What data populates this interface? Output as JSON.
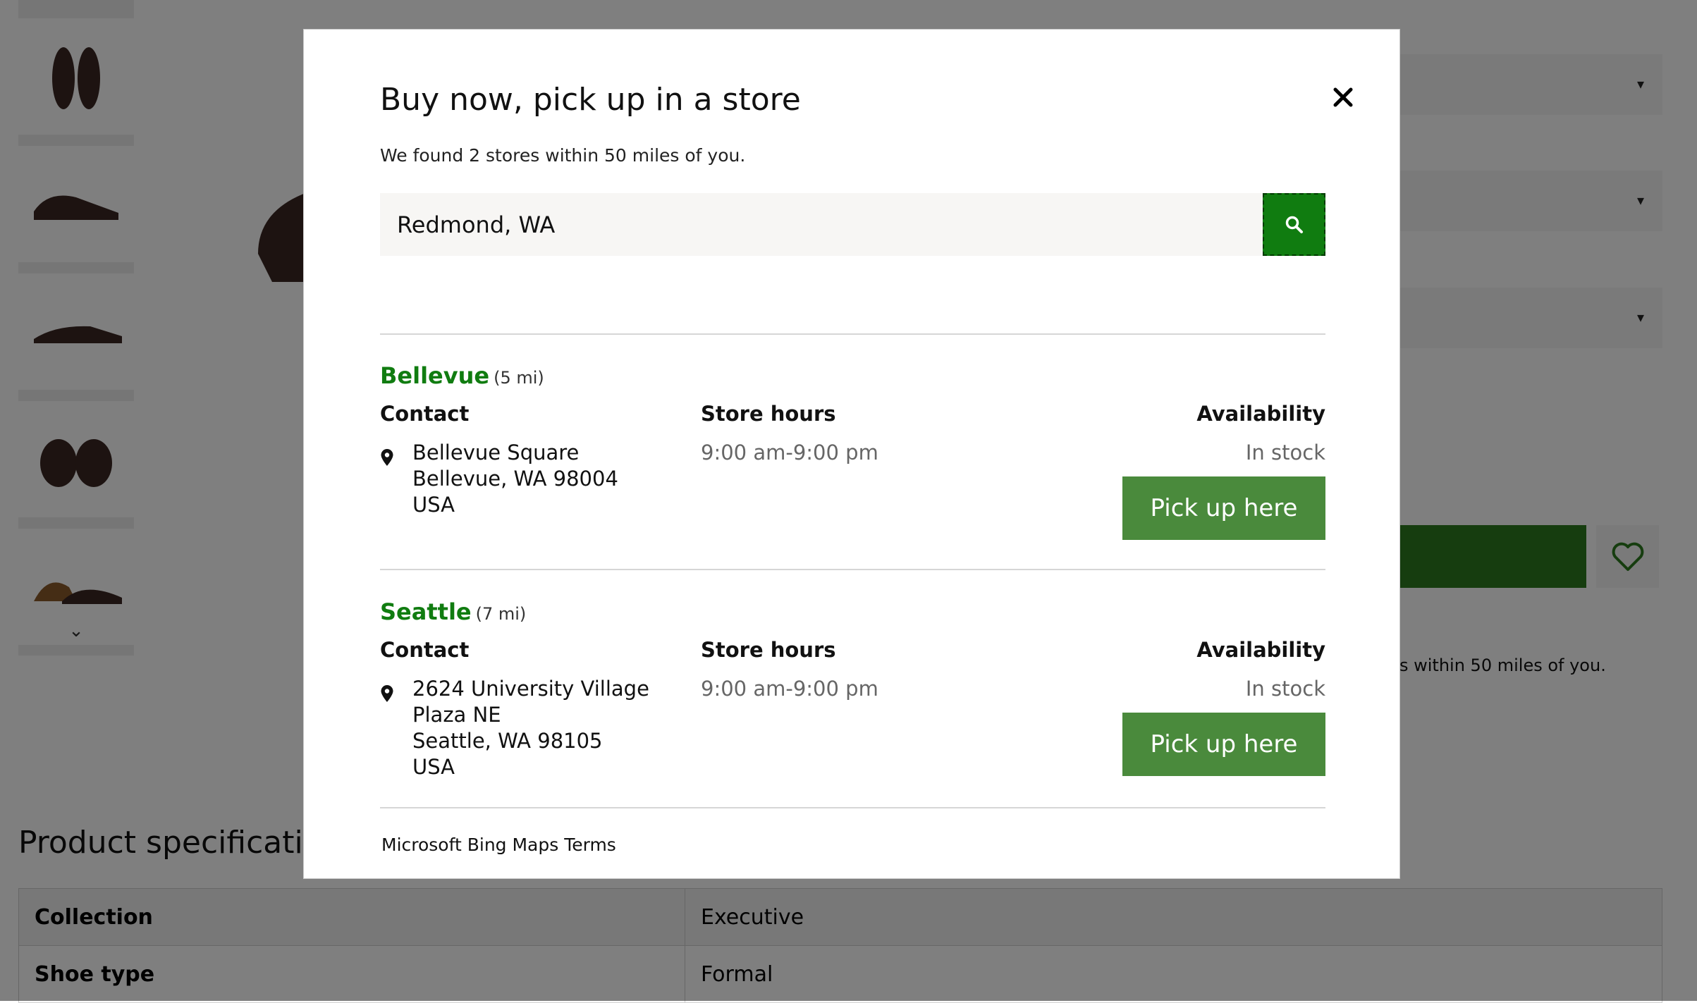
{
  "background": {
    "found_text": "s within 50 miles of you.",
    "spec_title": "Product specifications",
    "specs": [
      {
        "key": "Collection",
        "value": "Executive"
      },
      {
        "key": "Shoe type",
        "value": "Formal"
      }
    ],
    "thumbnail_count": 5
  },
  "modal": {
    "title": "Buy now, pick up in a store",
    "subtitle": "We found 2 stores within 50 miles of you.",
    "search": {
      "value": "Redmond, WA"
    },
    "columns": {
      "contact": "Contact",
      "hours": "Store hours",
      "availability": "Availability"
    },
    "stores": [
      {
        "name": "Bellevue",
        "distance": "(5 mi)",
        "address_lines": [
          "Bellevue Square",
          "Bellevue, WA 98004",
          "USA"
        ],
        "hours": "9:00 am-9:00 pm",
        "availability": "In stock",
        "button": "Pick up here"
      },
      {
        "name": "Seattle",
        "distance": "(7 mi)",
        "address_lines": [
          "2624 University Village Plaza NE",
          "Seattle, WA 98105",
          "USA"
        ],
        "hours": "9:00 am-9:00 pm",
        "availability": "In stock",
        "button": "Pick up here"
      }
    ],
    "terms_link": "Microsoft Bing Maps Terms"
  },
  "icons": {
    "close": "close-icon",
    "search": "search-icon",
    "pin": "location-pin-icon",
    "heart": "heart-icon",
    "chevron": "chevron-down-icon"
  },
  "colors": {
    "brand_green": "#107c10",
    "button_green": "#4a8a3c",
    "cart_green": "#2d7a1f"
  }
}
